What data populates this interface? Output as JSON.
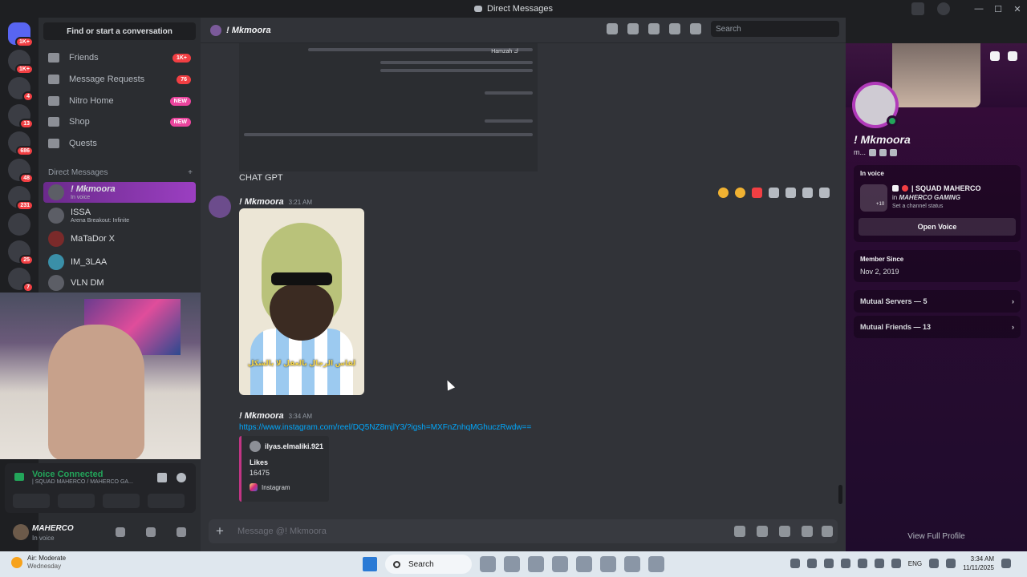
{
  "window": {
    "title": "Direct Messages",
    "controls": [
      "minimize",
      "maximize",
      "close"
    ]
  },
  "servers": [
    {
      "badge": "1K+"
    },
    {
      "badge": "1K+"
    },
    {
      "badge": "4"
    },
    {
      "badge": "13"
    },
    {
      "badge": "686"
    },
    {
      "badge": "48"
    },
    {
      "badge": "231"
    },
    {
      "badge": ""
    },
    {
      "badge": "25"
    },
    {
      "badge": "7"
    }
  ],
  "sidebar": {
    "find": "Find or start a conversation",
    "nav": [
      {
        "label": "Friends",
        "badge": "1K+",
        "badge_kind": "red"
      },
      {
        "label": "Message Requests",
        "badge": "76",
        "badge_kind": "red"
      },
      {
        "label": "Nitro Home",
        "badge": "NEW",
        "badge_kind": "new"
      },
      {
        "label": "Shop",
        "badge": "NEW",
        "badge_kind": "new"
      },
      {
        "label": "Quests",
        "badge": "",
        "badge_kind": ""
      }
    ],
    "dm_header": "Direct Messages",
    "dm_add": "+",
    "dms": [
      {
        "name": "! Mkmoora",
        "sub": "In voice",
        "active": true
      },
      {
        "name": "ISSA",
        "sub": "Arena Breakout: Infinite",
        "active": false
      },
      {
        "name": "MaTaDor X",
        "sub": "",
        "active": false
      },
      {
        "name": "IM_3LAA",
        "sub": "",
        "active": false
      },
      {
        "name": "VLN DM",
        "sub": "",
        "active": false
      }
    ]
  },
  "voice": {
    "status": "Voice Connected",
    "channel": "| SQUAD MAHERCO / MAHERCO GA..."
  },
  "user": {
    "name": "MAHERCO",
    "status": "In voice"
  },
  "chat": {
    "header_name": "! Mkmoora",
    "search_placeholder": "Search",
    "prev_text": "CHAT GPT",
    "prev_author": "Hamzah ك",
    "messages": [
      {
        "author": "! Mkmoora",
        "time": "3:21 AM",
        "sticker_caption": "لقاس الرجال بالعقل لا بالشكل"
      },
      {
        "author": "! Mkmoora",
        "time": "3:34 AM",
        "link": "https://www.instagram.com/reel/DQ5NZ8mjlY3/?igsh=MXFnZnhqMGhuczRwdw==",
        "embed": {
          "author": "ilyas.elmaliki.921",
          "title": "Likes",
          "count": "16475",
          "provider": "Instagram"
        }
      }
    ],
    "composer_placeholder": "Message @! Mkmoora"
  },
  "profile": {
    "name": "! Mkmoora",
    "username": "m...",
    "in_voice_label": "In voice",
    "channel": "| SQUAD MAHERCO",
    "guild_prefix": "in",
    "guild": "MAHERCO GAMING",
    "channel_status": "Set a channel status",
    "extra": "+10",
    "open_voice": "Open Voice",
    "member_since_label": "Member Since",
    "member_since": "Nov 2, 2019",
    "mutual_servers": "Mutual Servers — 5",
    "mutual_friends": "Mutual Friends — 13",
    "view_full": "View Full Profile"
  },
  "taskbar": {
    "weather_1": "Air: Moderate",
    "weather_2": "Wednesday",
    "search": "Search",
    "lang": "ENG",
    "time": "3:34 AM",
    "date": "11/11/2025"
  },
  "colors": {
    "accent": "#5865f2",
    "online": "#23a55a",
    "danger": "#f23f43",
    "nitro": "#eb459e",
    "link": "#00a8fc"
  }
}
